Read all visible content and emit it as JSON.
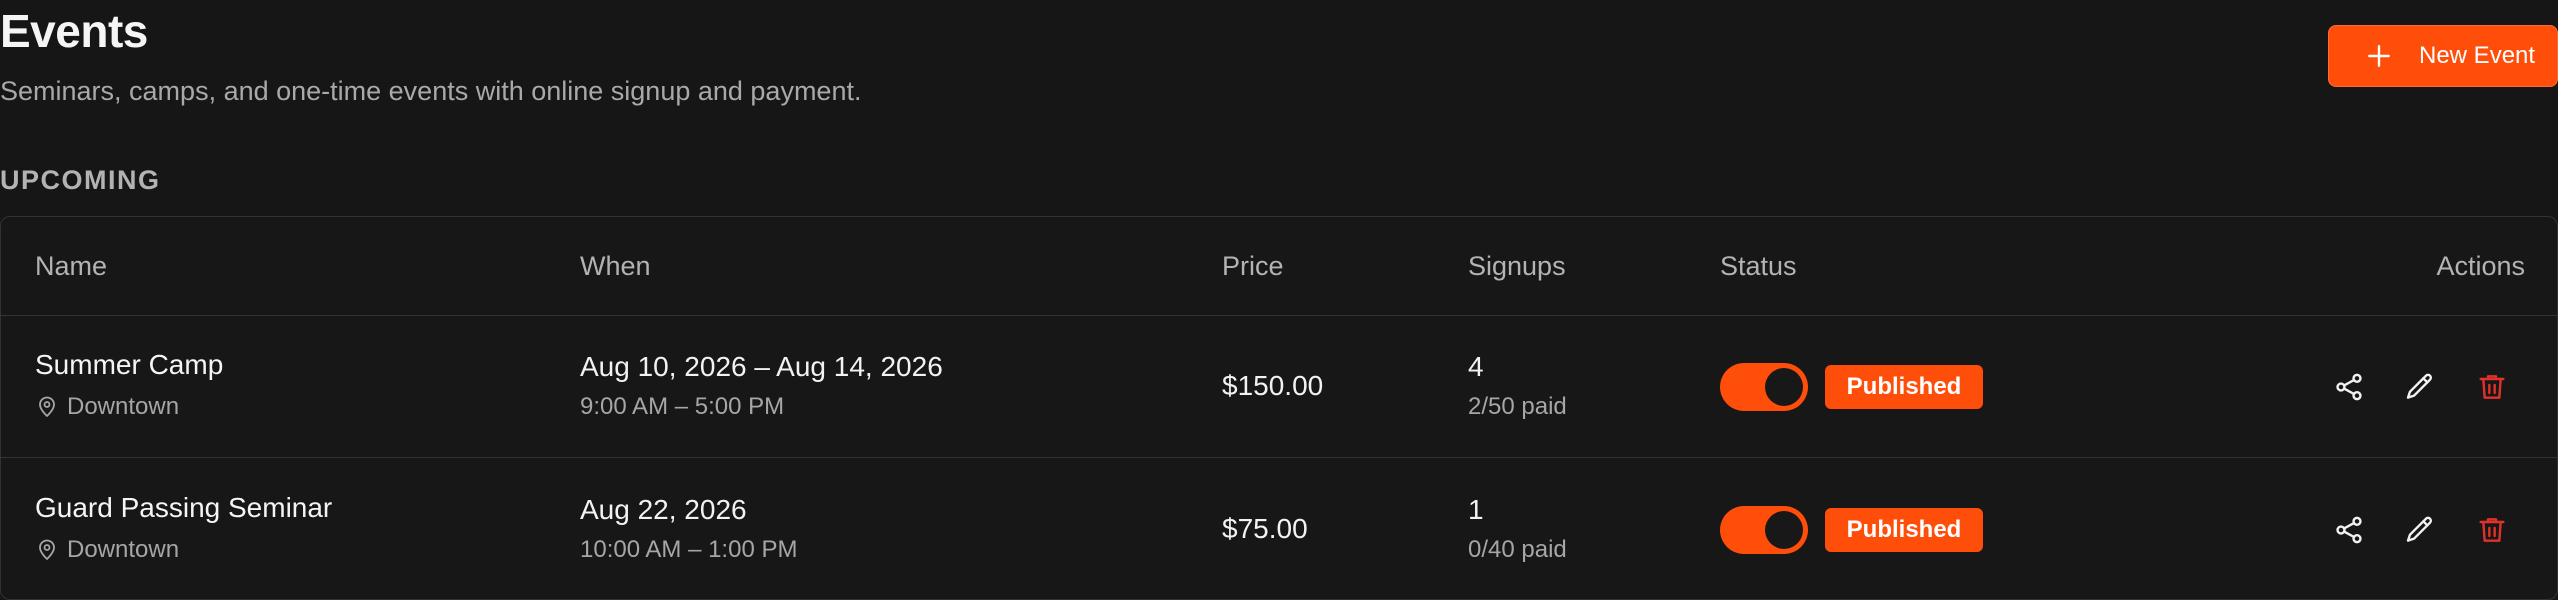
{
  "header": {
    "title": "Events",
    "subtitle": "Seminars, camps, and one-time events with online signup and payment.",
    "new_button_label": "New Event"
  },
  "section": {
    "label": "UPCOMING"
  },
  "table": {
    "columns": [
      "Name",
      "When",
      "Price",
      "Signups",
      "Status",
      "Actions"
    ],
    "rows": [
      {
        "name": "Summer Camp",
        "location": "Downtown",
        "when_date": "Aug 10, 2026 – Aug 14, 2026",
        "when_time": "9:00 AM – 5:00 PM",
        "price": "$150.00",
        "signups": "4",
        "paid": "2/50 paid",
        "published": true,
        "status": "Published"
      },
      {
        "name": "Guard Passing Seminar",
        "location": "Downtown",
        "when_date": "Aug 22, 2026",
        "when_time": "10:00 AM – 1:00 PM",
        "price": "$75.00",
        "signups": "1",
        "paid": "0/40 paid",
        "published": true,
        "status": "Published"
      }
    ]
  },
  "icons": {
    "new_button": "plus-icon",
    "location": "map-pin-icon",
    "share": "share-icon",
    "edit": "pencil-icon",
    "delete": "trash-icon"
  },
  "colors": {
    "accent": "#ff4d0a",
    "danger": "#e0322a",
    "background": "#161616"
  }
}
